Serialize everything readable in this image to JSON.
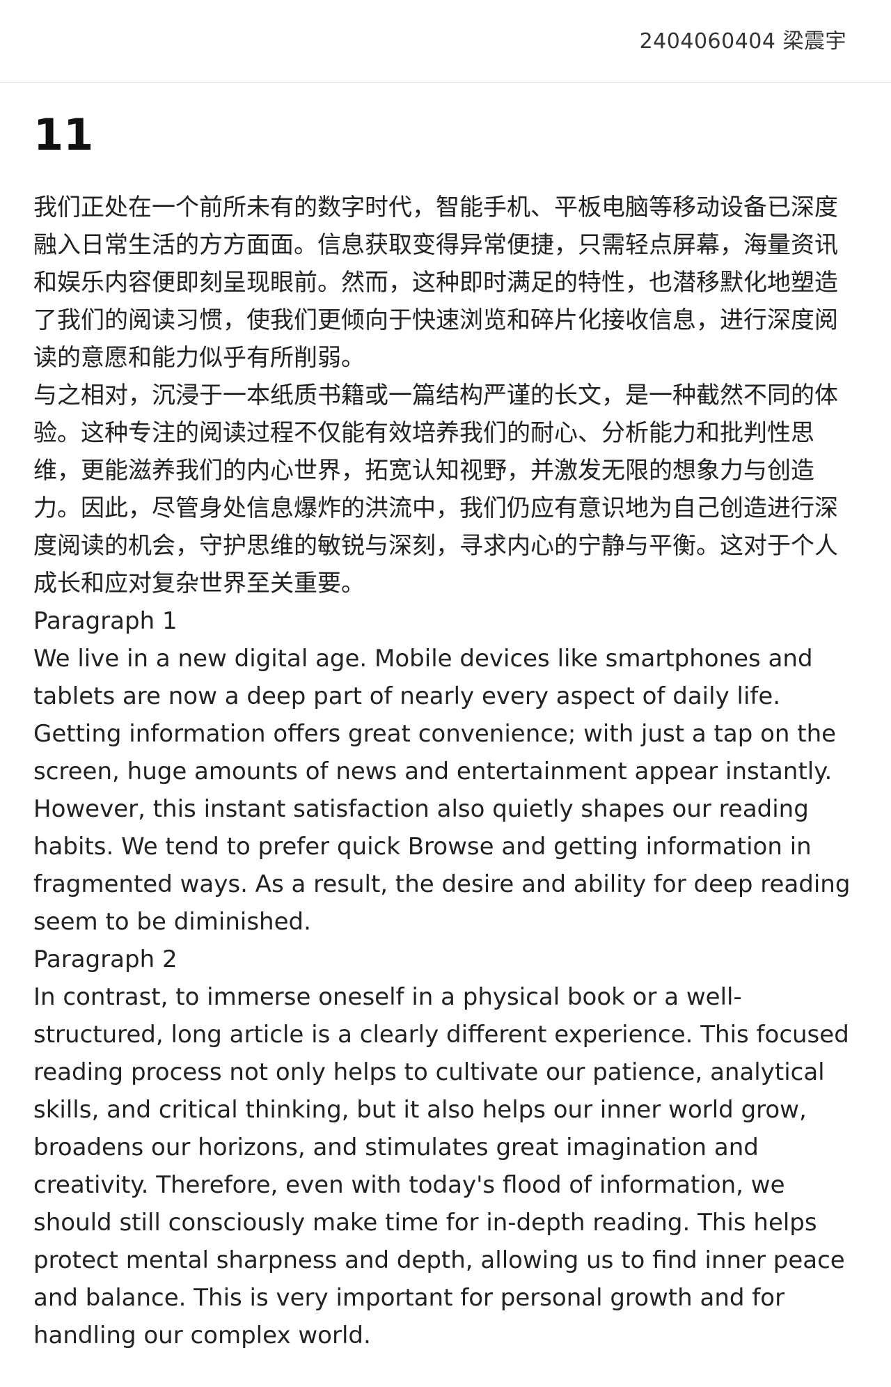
{
  "header": {
    "author": "2404060404 梁震宇"
  },
  "document": {
    "title": "11",
    "paragraphs": [
      "我们正处在一个前所未有的数字时代，智能手机、平板电脑等移动设备已深度融入日常生活的方方面面。信息获取变得异常便捷，只需轻点屏幕，海量资讯和娱乐内容便即刻呈现眼前。然而，这种即时满足的特性，也潜移默化地塑造了我们的阅读习惯，使我们更倾向于快速浏览和碎片化接收信息，进行深度阅读的意愿和能力似乎有所削弱。",
      "与之相对，沉浸于一本纸质书籍或一篇结构严谨的长文，是一种截然不同的体验。这种专注的阅读过程不仅能有效培养我们的耐心、分析能力和批判性思维，更能滋养我们的内心世界，拓宽认知视野，并激发无限的想象力与创造力。因此，尽管身处信息爆炸的洪流中，我们仍应有意识地为自己创造进行深度阅读的机会，守护思维的敏锐与深刻，寻求内心的宁静与平衡。这对于个人成长和应对复杂世界至关重要。",
      "Paragraph 1",
      "We live in a new digital age. Mobile devices like smartphones and tablets are now a deep part of nearly every aspect of daily life. Getting information offers great convenience; with just a tap on the screen, huge amounts of news and entertainment appear instantly. However, this instant satisfaction also quietly shapes our reading habits. We tend to prefer quick Browse and getting information in fragmented ways. As a result, the desire and ability for deep reading seem to be diminished.",
      "Paragraph 2",
      "In contrast, to immerse oneself in a physical book or a well-structured, long article is a clearly different experience. This focused reading process not only helps to cultivate our patience, analytical skills, and critical thinking, but it also helps our inner world grow, broadens our horizons, and stimulates great imagination and creativity. Therefore, even with today's flood of information, we should still consciously make time for in-depth reading. This helps protect mental sharpness and depth, allowing us to find inner peace and balance. This is very important for personal growth and for handling our complex world."
    ]
  }
}
